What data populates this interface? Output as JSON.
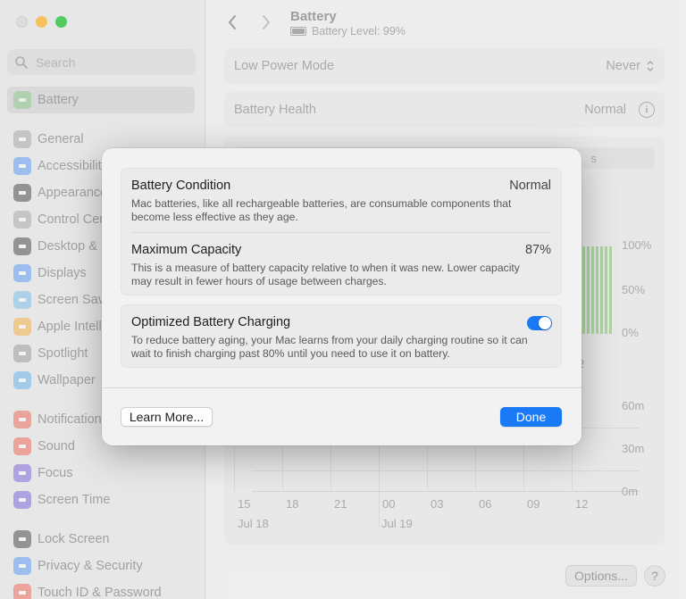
{
  "sidebar": {
    "search_placeholder": "Search",
    "items": [
      {
        "label": "Battery",
        "icon": "battery-icon",
        "color": "#7cc27a"
      },
      {
        "label": "General",
        "icon": "gear-icon",
        "color": "#9a9a9a"
      },
      {
        "label": "Accessibility",
        "icon": "accessibility-icon",
        "color": "#3d8cf5"
      },
      {
        "label": "Appearance",
        "icon": "appearance-icon",
        "color": "#2b2b2b"
      },
      {
        "label": "Control Centre",
        "icon": "control-centre-icon",
        "color": "#9a9a9a"
      },
      {
        "label": "Desktop & Dock",
        "icon": "desktop-icon",
        "color": "#2b2b2b"
      },
      {
        "label": "Displays",
        "icon": "displays-icon",
        "color": "#3d8cf5"
      },
      {
        "label": "Screen Saver",
        "icon": "screen-saver-icon",
        "color": "#66b6e8"
      },
      {
        "label": "Apple Intelligence",
        "icon": "apple-intelligence-icon",
        "color": "#f5a623"
      },
      {
        "label": "Spotlight",
        "icon": "spotlight-icon",
        "color": "#8a8a8a"
      },
      {
        "label": "Wallpaper",
        "icon": "wallpaper-icon",
        "color": "#4aa8e8"
      },
      {
        "label": "Notifications",
        "icon": "notifications-icon",
        "color": "#f0513f"
      },
      {
        "label": "Sound",
        "icon": "sound-icon",
        "color": "#f0513f"
      },
      {
        "label": "Focus",
        "icon": "focus-icon",
        "color": "#6a4fd6"
      },
      {
        "label": "Screen Time",
        "icon": "screen-time-icon",
        "color": "#6a4fd6"
      },
      {
        "label": "Lock Screen",
        "icon": "lock-icon",
        "color": "#2b2b2b"
      },
      {
        "label": "Privacy & Security",
        "icon": "hand-icon",
        "color": "#3d8cf5"
      },
      {
        "label": "Touch ID & Password",
        "icon": "fingerprint-icon",
        "color": "#f0513f"
      }
    ]
  },
  "header": {
    "title": "Battery",
    "subtitle": "Battery Level: 99%"
  },
  "settings": {
    "low_power_label": "Low Power Mode",
    "low_power_value": "Never",
    "health_label": "Battery Health",
    "health_value": "Normal"
  },
  "chart": {
    "segment_tail": "s",
    "level_ticks": [
      "100%",
      "50%",
      "0%"
    ],
    "level_x_label_partial": "2",
    "usage_ticks": [
      "60m",
      "30m",
      "0m"
    ],
    "x_ticks": [
      "15",
      "18",
      "21",
      "00",
      "03",
      "06",
      "09",
      "12"
    ],
    "x_dates": [
      "Jul 18",
      "Jul 19"
    ]
  },
  "footer": {
    "options_label": "Options...",
    "help_label": "?"
  },
  "modal": {
    "condition_title": "Battery Condition",
    "condition_value": "Normal",
    "condition_desc": "Mac batteries, like all rechargeable batteries, are consumable components that become less effective as they age.",
    "capacity_title": "Maximum Capacity",
    "capacity_value": "87%",
    "capacity_desc": "This is a measure of battery capacity relative to when it was new. Lower capacity may result in fewer hours of usage between charges.",
    "optimized_title": "Optimized Battery Charging",
    "optimized_desc": "To reduce battery aging, your Mac learns from your daily charging routine so it can wait to finish charging past 80% until you need to use it on battery.",
    "optimized_on": true,
    "learn_more_label": "Learn More...",
    "done_label": "Done"
  },
  "colors": {
    "accent": "#1a79f5",
    "battery_green": "#7cc27a"
  }
}
